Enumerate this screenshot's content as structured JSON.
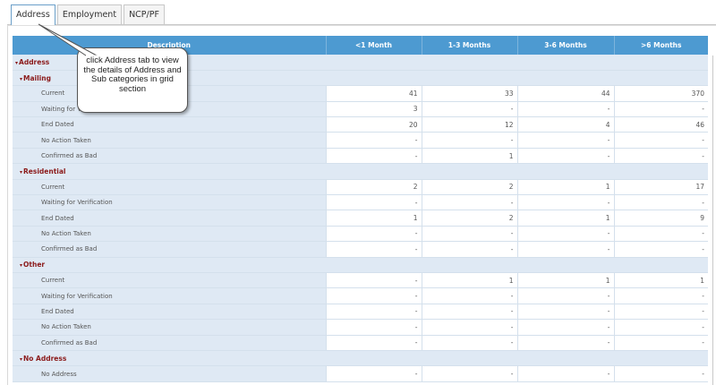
{
  "tabs": [
    {
      "label": "Address",
      "active": true
    },
    {
      "label": "Employment",
      "active": false
    },
    {
      "label": "NCP/PF",
      "active": false
    }
  ],
  "callout": {
    "text": "click Address tab to view the details of Address and Sub categories  in grid section"
  },
  "grid": {
    "columns": [
      "Description",
      "<1 Month",
      "1-3 Months",
      "3-6 Months",
      ">6 Months"
    ],
    "category": "Address",
    "arrow": "▾",
    "groups": [
      {
        "name": "Mailing",
        "rows": [
          {
            "label": "Current",
            "values": [
              "41",
              "33",
              "44",
              "370"
            ]
          },
          {
            "label": "Waiting for Verification",
            "values": [
              "3",
              "-",
              "-",
              "-"
            ]
          },
          {
            "label": "End Dated",
            "values": [
              "20",
              "12",
              "4",
              "46"
            ]
          },
          {
            "label": "No Action Taken",
            "values": [
              "-",
              "-",
              "-",
              "-"
            ]
          },
          {
            "label": "Confirmed as Bad",
            "values": [
              "-",
              "1",
              "-",
              "-"
            ]
          }
        ]
      },
      {
        "name": "Residential",
        "rows": [
          {
            "label": "Current",
            "values": [
              "2",
              "2",
              "1",
              "17"
            ]
          },
          {
            "label": "Waiting for Verification",
            "values": [
              "-",
              "-",
              "-",
              "-"
            ]
          },
          {
            "label": "End Dated",
            "values": [
              "1",
              "2",
              "1",
              "9"
            ]
          },
          {
            "label": "No Action Taken",
            "values": [
              "-",
              "-",
              "-",
              "-"
            ]
          },
          {
            "label": "Confirmed as Bad",
            "values": [
              "-",
              "-",
              "-",
              "-"
            ]
          }
        ]
      },
      {
        "name": "Other",
        "rows": [
          {
            "label": "Current",
            "values": [
              "-",
              "1",
              "1",
              "1"
            ]
          },
          {
            "label": "Waiting for Verification",
            "values": [
              "-",
              "-",
              "-",
              "-"
            ]
          },
          {
            "label": "End Dated",
            "values": [
              "-",
              "-",
              "-",
              "-"
            ]
          },
          {
            "label": "No Action Taken",
            "values": [
              "-",
              "-",
              "-",
              "-"
            ]
          },
          {
            "label": "Confirmed as Bad",
            "values": [
              "-",
              "-",
              "-",
              "-"
            ]
          }
        ]
      },
      {
        "name": "No Address",
        "rows": [
          {
            "label": "No Address",
            "values": [
              "-",
              "-",
              "-",
              "-"
            ]
          }
        ]
      }
    ]
  }
}
